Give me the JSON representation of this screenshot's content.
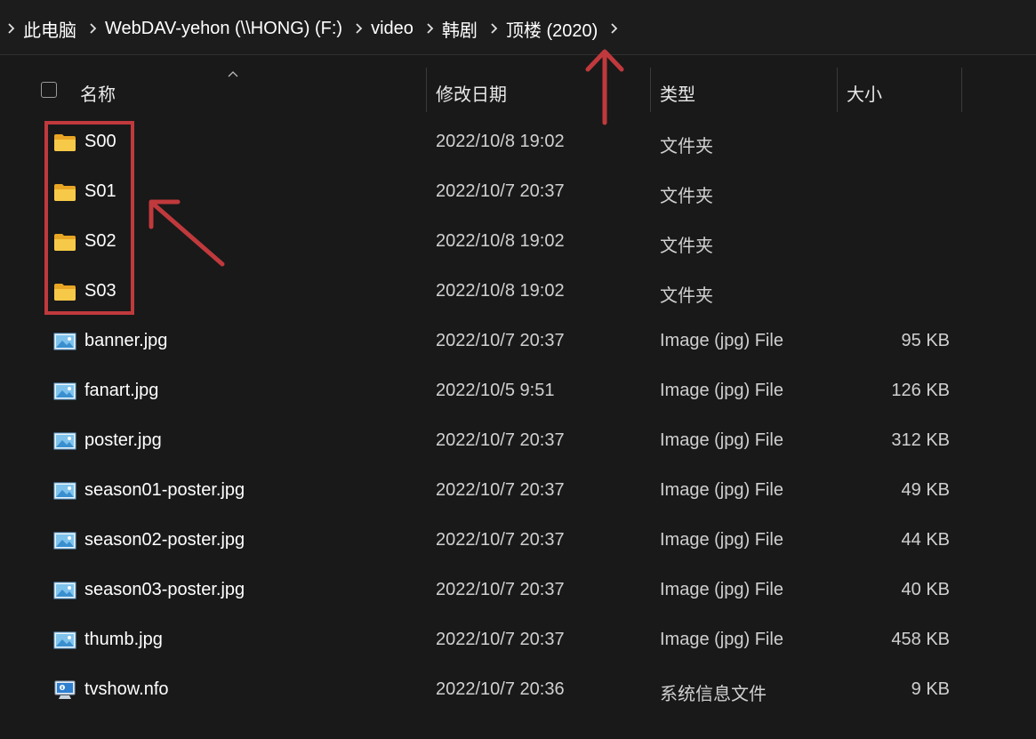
{
  "breadcrumb": {
    "items": [
      "此电脑",
      "WebDAV-yehon (\\\\HONG) (F:)",
      "video",
      "韩剧",
      "顶楼 (2020)"
    ]
  },
  "columns": {
    "name": "名称",
    "modified": "修改日期",
    "type": "类型",
    "size": "大小"
  },
  "files": [
    {
      "name": "S00",
      "modified": "2022/10/8 19:02",
      "type": "文件夹",
      "size": "",
      "icon": "folder-icon"
    },
    {
      "name": "S01",
      "modified": "2022/10/7 20:37",
      "type": "文件夹",
      "size": "",
      "icon": "folder-icon"
    },
    {
      "name": "S02",
      "modified": "2022/10/8 19:02",
      "type": "文件夹",
      "size": "",
      "icon": "folder-icon"
    },
    {
      "name": "S03",
      "modified": "2022/10/8 19:02",
      "type": "文件夹",
      "size": "",
      "icon": "folder-icon"
    },
    {
      "name": "banner.jpg",
      "modified": "2022/10/7 20:37",
      "type": "Image (jpg) File",
      "size": "95 KB",
      "icon": "image-file-icon"
    },
    {
      "name": "fanart.jpg",
      "modified": "2022/10/5 9:51",
      "type": "Image (jpg) File",
      "size": "126 KB",
      "icon": "image-file-icon"
    },
    {
      "name": "poster.jpg",
      "modified": "2022/10/7 20:37",
      "type": "Image (jpg) File",
      "size": "312 KB",
      "icon": "image-file-icon"
    },
    {
      "name": "season01-poster.jpg",
      "modified": "2022/10/7 20:37",
      "type": "Image (jpg) File",
      "size": "49 KB",
      "icon": "image-file-icon"
    },
    {
      "name": "season02-poster.jpg",
      "modified": "2022/10/7 20:37",
      "type": "Image (jpg) File",
      "size": "44 KB",
      "icon": "image-file-icon"
    },
    {
      "name": "season03-poster.jpg",
      "modified": "2022/10/7 20:37",
      "type": "Image (jpg) File",
      "size": "40 KB",
      "icon": "image-file-icon"
    },
    {
      "name": "thumb.jpg",
      "modified": "2022/10/7 20:37",
      "type": "Image (jpg) File",
      "size": "458 KB",
      "icon": "image-file-icon"
    },
    {
      "name": "tvshow.nfo",
      "modified": "2022/10/7 20:36",
      "type": "系统信息文件",
      "size": "9 KB",
      "icon": "system-info-file-icon"
    }
  ],
  "colors": {
    "background": "#191919",
    "annotation": "#c0393c",
    "folder": "#f5c342"
  }
}
